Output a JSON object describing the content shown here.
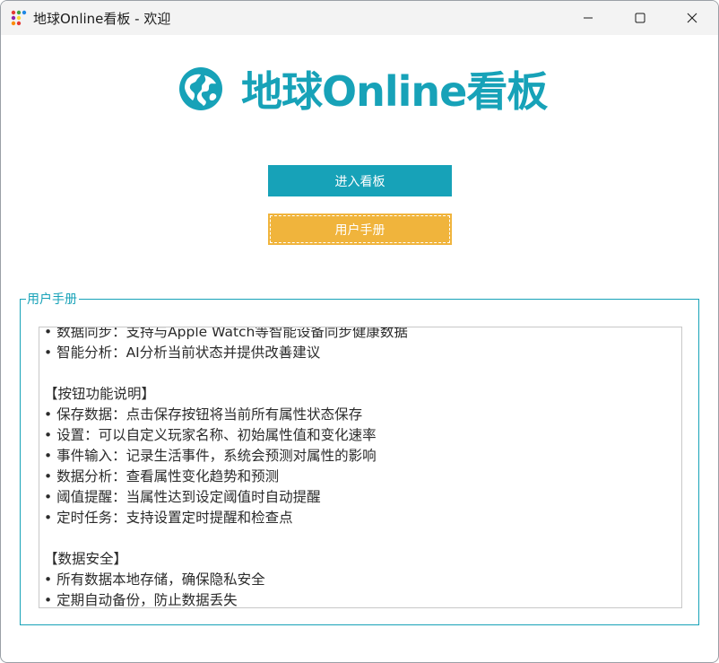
{
  "window": {
    "title": "地球Online看板 - 欢迎"
  },
  "header": {
    "logo_text": "地球Online看板",
    "logo_icon": "globe-icon",
    "accent_color": "#17a2b8"
  },
  "buttons": {
    "enter_label": "进入看板",
    "manual_label": "用户手册",
    "enter_color": "#17a2b8",
    "manual_color": "#f0b43c"
  },
  "manual": {
    "group_title": "用户手册",
    "lines": [
      "• 数据同步：支持与Apple Watch等智能设备同步健康数据",
      "• 智能分析：AI分析当前状态并提供改善建议",
      "",
      "【按钮功能说明】",
      "• 保存数据：点击保存按钮将当前所有属性状态保存",
      "• 设置：可以自定义玩家名称、初始属性值和变化速率",
      "• 事件输入：记录生活事件，系统会预测对属性的影响",
      "• 数据分析：查看属性变化趋势和预测",
      "• 阈值提醒：当属性达到设定阈值时自动提醒",
      "• 定时任务：支持设置定时提醒和检查点",
      "",
      "【数据安全】",
      "• 所有数据本地存储，确保隐私安全",
      "• 定期自动备份，防止数据丢失"
    ]
  }
}
